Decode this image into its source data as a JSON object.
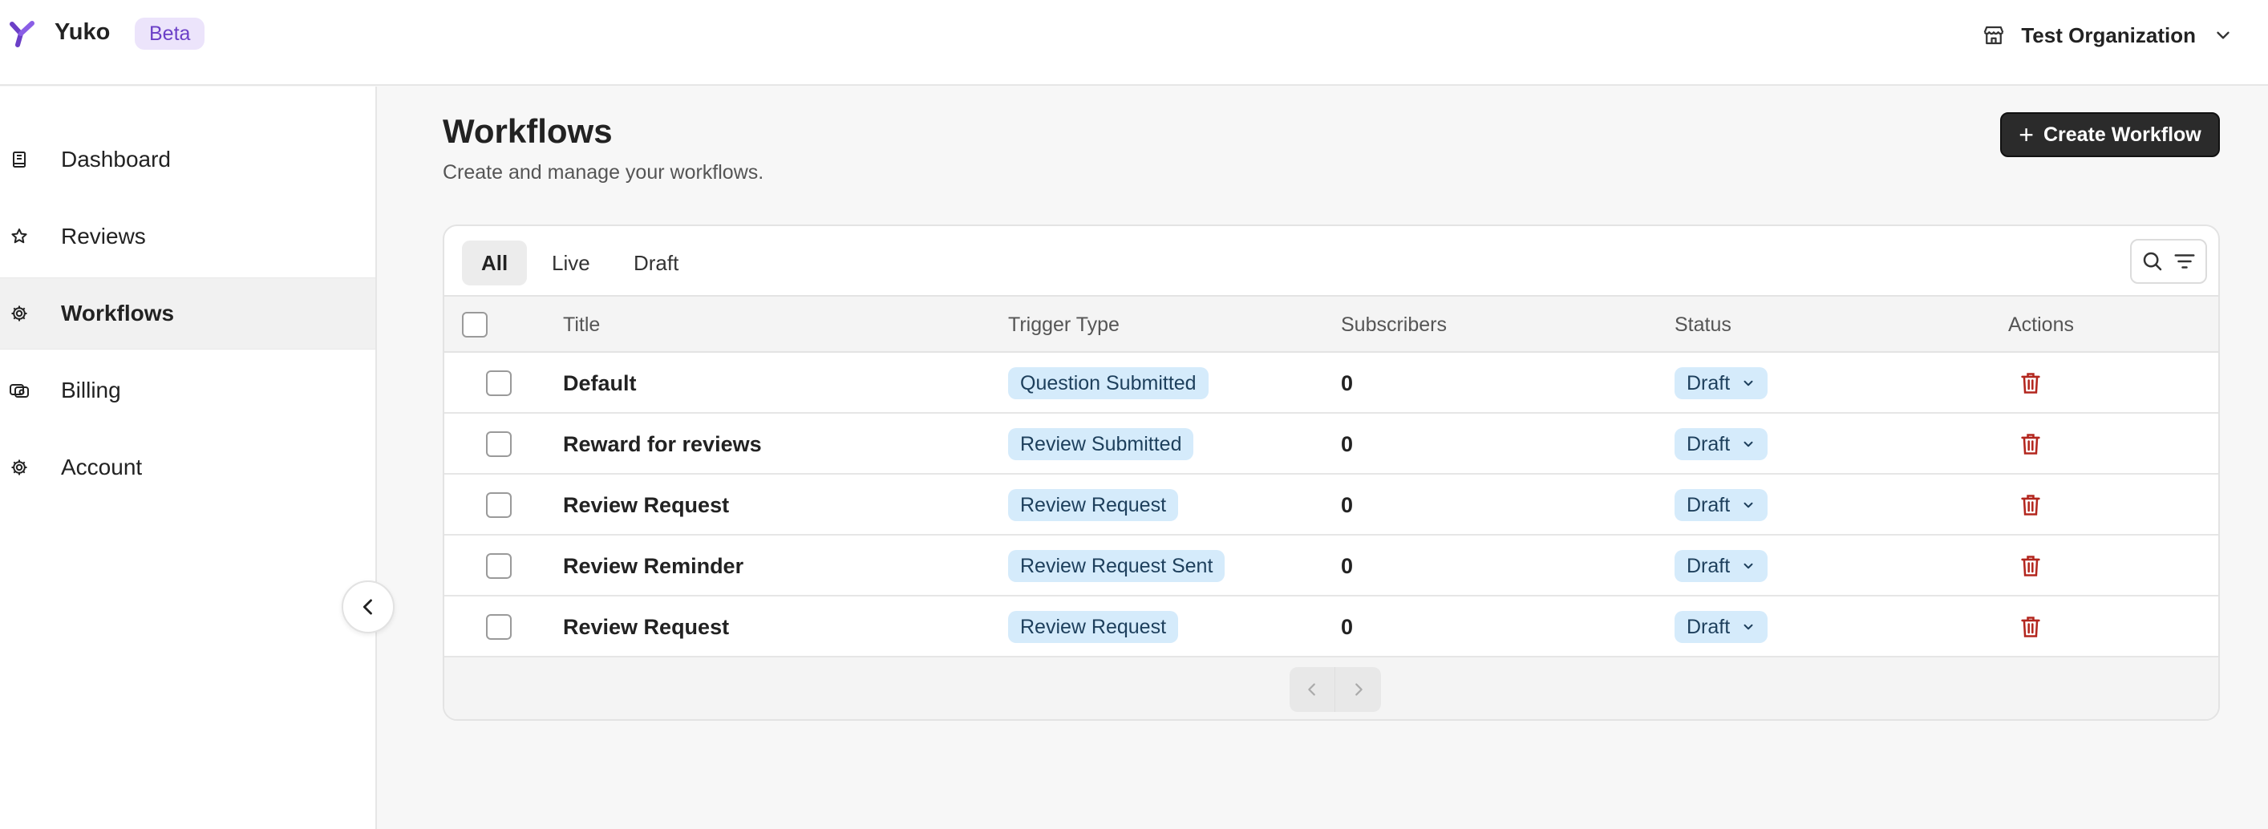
{
  "header": {
    "brand": "Yuko",
    "badge": "Beta",
    "organization": "Test Organization",
    "logo_icon": "yuko-logo",
    "org_icon": "store-icon",
    "chevron_icon": "chevron-down-icon"
  },
  "sidebar": {
    "items": [
      {
        "label": "Dashboard",
        "icon": "book-icon",
        "active": false
      },
      {
        "label": "Reviews",
        "icon": "star-icon",
        "active": false
      },
      {
        "label": "Workflows",
        "icon": "gear-icon",
        "active": true
      },
      {
        "label": "Billing",
        "icon": "coins-icon",
        "active": false
      },
      {
        "label": "Account",
        "icon": "gear-icon",
        "active": false
      }
    ],
    "collapse_icon": "chevron-left-icon"
  },
  "main": {
    "title": "Workflows",
    "subtitle": "Create and manage your workflows.",
    "create_button": "Create Workflow",
    "tabs": [
      {
        "label": "All",
        "active": true
      },
      {
        "label": "Live",
        "active": false
      },
      {
        "label": "Draft",
        "active": false
      }
    ],
    "table": {
      "columns": [
        "Title",
        "Trigger Type",
        "Subscribers",
        "Status",
        "Actions"
      ],
      "rows": [
        {
          "title": "Default",
          "trigger": "Question Submitted",
          "subscribers": "0",
          "status": "Draft"
        },
        {
          "title": "Reward for reviews",
          "trigger": "Review Submitted",
          "subscribers": "0",
          "status": "Draft"
        },
        {
          "title": "Review Request",
          "trigger": "Review Request",
          "subscribers": "0",
          "status": "Draft"
        },
        {
          "title": "Review Reminder",
          "trigger": "Review Request Sent",
          "subscribers": "0",
          "status": "Draft"
        },
        {
          "title": "Review Request",
          "trigger": "Review Request",
          "subscribers": "0",
          "status": "Draft"
        }
      ]
    }
  },
  "colors": {
    "accent": "#6b3fc7",
    "badge_bg": "#ece4fb",
    "pill_bg": "#d5ebfb",
    "delete": "#b3261e",
    "primary_button": "#2b2b2b"
  }
}
